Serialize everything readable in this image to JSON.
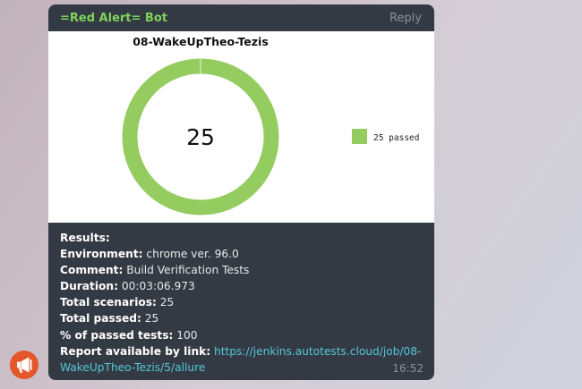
{
  "message": {
    "sender": "=Red Alert= Bot",
    "reply_label": "Reply",
    "time": "16:52"
  },
  "chart_data": {
    "type": "pie",
    "title": "08-WakeUpTheo-Tezis",
    "center_label": "25",
    "series": [
      {
        "name": "25 passed",
        "value": 25,
        "color": "#94cc60"
      }
    ]
  },
  "report": {
    "results_label": "Results:",
    "environment_label": "Environment:",
    "environment_value": "chrome ver. 96.0",
    "comment_label": "Comment:",
    "comment_value": "Build Verification Tests",
    "duration_label": "Duration:",
    "duration_value": "00:03:06.973",
    "total_scenarios_label": "Total scenarios:",
    "total_scenarios_value": "25",
    "total_passed_label": "Total passed:",
    "total_passed_value": "25",
    "percent_passed_label": "% of passed tests:",
    "percent_passed_value": "100",
    "report_link_label": "Report available by link:",
    "report_link_line1": "https://jenkins.autotests.cloud/job/08-",
    "report_link_line2": "WakeUpTheo-Tezis/5/allure"
  },
  "colors": {
    "sender": "#7ed25d",
    "link": "#54c7d9",
    "donut": "#94cc60",
    "bubble": "#343a43",
    "avatar": "#e5572a"
  },
  "icons": {
    "avatar": "megaphone-icon"
  }
}
